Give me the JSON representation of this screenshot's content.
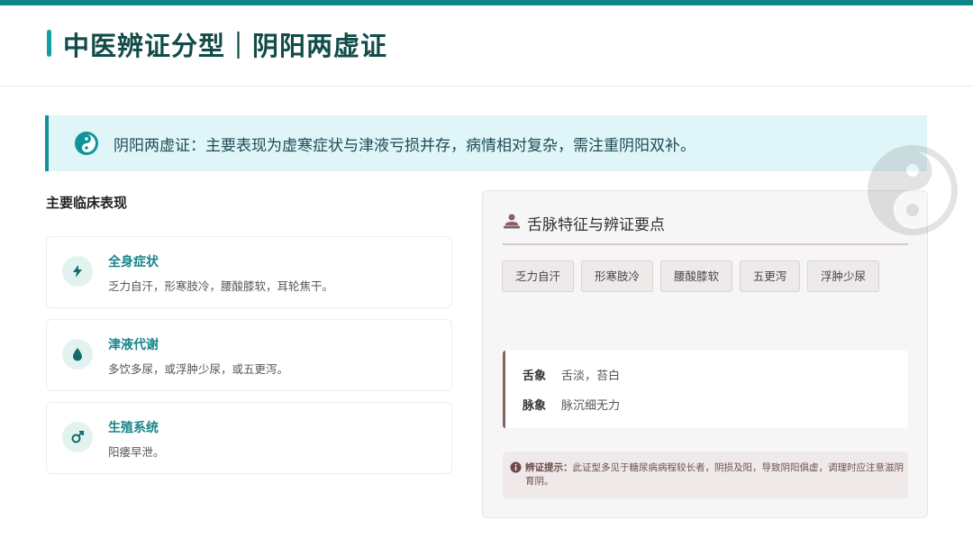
{
  "header": {
    "title": "中医辨证分型｜阴阳两虚证"
  },
  "banner": {
    "icon": "yin-yang-icon",
    "text": "阴阳两虚证：主要表现为虚寒症状与津液亏损并存，病情相对复杂，需注重阴阳双补。"
  },
  "clinical": {
    "section_title": "主要临床表现",
    "cards": [
      {
        "icon": "lightning-icon",
        "title": "全身症状",
        "desc": "乏力自汗，形寒肢冷，腰酸膝软，耳轮焦干。"
      },
      {
        "icon": "droplet-icon",
        "title": "津液代谢",
        "desc": "多饮多尿，或浮肿少尿，或五更泻。"
      },
      {
        "icon": "male-symbol-icon",
        "title": "生殖系统",
        "desc": "阳痿早泄。"
      }
    ]
  },
  "panel": {
    "icon": "doctor-icon",
    "title": "舌脉特征与辨证要点",
    "tags": [
      "乏力自汗",
      "形寒肢冷",
      "腰酸膝软",
      "五更泻",
      "浮肿少尿"
    ],
    "tongue": {
      "label": "舌象",
      "value": "舌淡，苔白"
    },
    "pulse": {
      "label": "脉象",
      "value": "脉沉细无力"
    },
    "tip": {
      "label": "辨证提示：",
      "text": "此证型多见于糖尿病病程较长者，阴损及阳，导致阴阳俱虚，调理时应注意滋阴育阴。"
    }
  },
  "colors": {
    "accent": "#0e8487",
    "heading": "#124c48",
    "banner_bg": "#e0f5f8",
    "card_title": "#17858a",
    "panel_border": "#8a6161"
  }
}
